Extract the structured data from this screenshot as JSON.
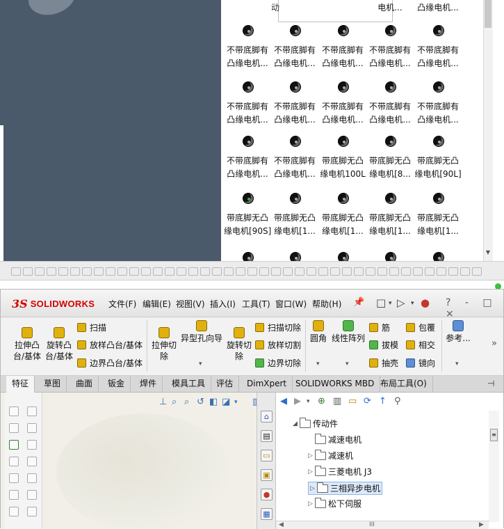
{
  "library": {
    "preview_label": "动",
    "rows": [
      {
        "labels": [
          [
            "",
            ""
          ],
          [
            "",
            ""
          ],
          [
            "",
            ""
          ],
          [
            "",
            ""
          ],
          [
            "",
            ""
          ]
        ],
        "partial": [
          "",
          "",
          "",
          "电机...",
          "凸缘电机..."
        ]
      },
      {
        "labels": [
          [
            "不带底脚有",
            "凸缘电机..."
          ],
          [
            "不带底脚有",
            "凸缘电机..."
          ],
          [
            "不带底脚有",
            "凸缘电机..."
          ],
          [
            "不带底脚有",
            "凸缘电机..."
          ],
          [
            "不带底脚有",
            "凸缘电机..."
          ]
        ]
      },
      {
        "labels": [
          [
            "不带底脚有",
            "凸缘电机..."
          ],
          [
            "不带底脚有",
            "凸缘电机..."
          ],
          [
            "不带底脚有",
            "凸缘电机..."
          ],
          [
            "不带底脚有",
            "凸缘电机..."
          ],
          [
            "不带底脚有",
            "凸缘电机..."
          ]
        ]
      },
      {
        "labels": [
          [
            "不带底脚有",
            "凸缘电机..."
          ],
          [
            "不带底脚有",
            "凸缘电机..."
          ],
          [
            "带底脚无凸",
            "缘电机100L"
          ],
          [
            "带底脚无凸",
            "缘电机[8..."
          ],
          [
            "带底脚无凸",
            "缘电机[90L]"
          ]
        ]
      },
      {
        "labels": [
          [
            "带底脚无凸",
            "缘电机[90S]"
          ],
          [
            "带底脚无凸",
            "缘电机[1..."
          ],
          [
            "带底脚无凸",
            "缘电机[1..."
          ],
          [
            "带底脚无凸",
            "缘电机[1..."
          ],
          [
            "带底脚无凸",
            "缘电机[1..."
          ]
        ]
      }
    ]
  },
  "top_partial_labels": [
    "电机...",
    "凸缘电机..."
  ],
  "solidworks": {
    "logo_mark": "3S",
    "logo_text": "SOLIDWORKS",
    "menu": [
      "文件(F)",
      "编辑(E)",
      "视图(V)",
      "插入(I)",
      "工具(T)",
      "窗口(W)",
      "帮助(H)"
    ],
    "window_controls": "? - □ ×",
    "ribbon": {
      "extrude": "拉伸凸\n台/基体",
      "revolve": "旋转凸\n台/基体",
      "sweep": "扫描",
      "loft": "放样凸台/基体",
      "boundary": "边界凸台/基体",
      "extrude_cut": "拉伸切\n除",
      "hole_wizard": "异型孔向导",
      "revolve_cut": "旋转切\n除",
      "swept_cut": "扫描切除",
      "lofted_cut": "放样切割",
      "boundary_cut": "边界切除",
      "fillet": "圆角",
      "linear_pattern": "线性阵列",
      "rib": "筋",
      "wrap": "包覆",
      "draft": "拔模",
      "intersect": "相交",
      "shell": "抽壳",
      "mirror": "镜向",
      "reference": "参考..."
    },
    "tabs": [
      "特征",
      "草图",
      "曲面",
      "钣金",
      "焊件",
      "模具工具",
      "评估",
      "DimXpert",
      "SOLIDWORKS MBD",
      "布局工具(O)"
    ],
    "tree": [
      {
        "label": "传动件",
        "level": 0,
        "arrow": "◢"
      },
      {
        "label": "减速电机",
        "level": 1,
        "arrow": ""
      },
      {
        "label": "减速机",
        "level": 1,
        "arrow": "▷"
      },
      {
        "label": "三菱电机 J3",
        "level": 1,
        "arrow": "▷"
      },
      {
        "label": "三相异步电机",
        "level": 1,
        "arrow": "▷",
        "selected": true
      },
      {
        "label": "松下伺服",
        "level": 1,
        "arrow": "▷"
      }
    ],
    "scroll_mid": "III"
  }
}
